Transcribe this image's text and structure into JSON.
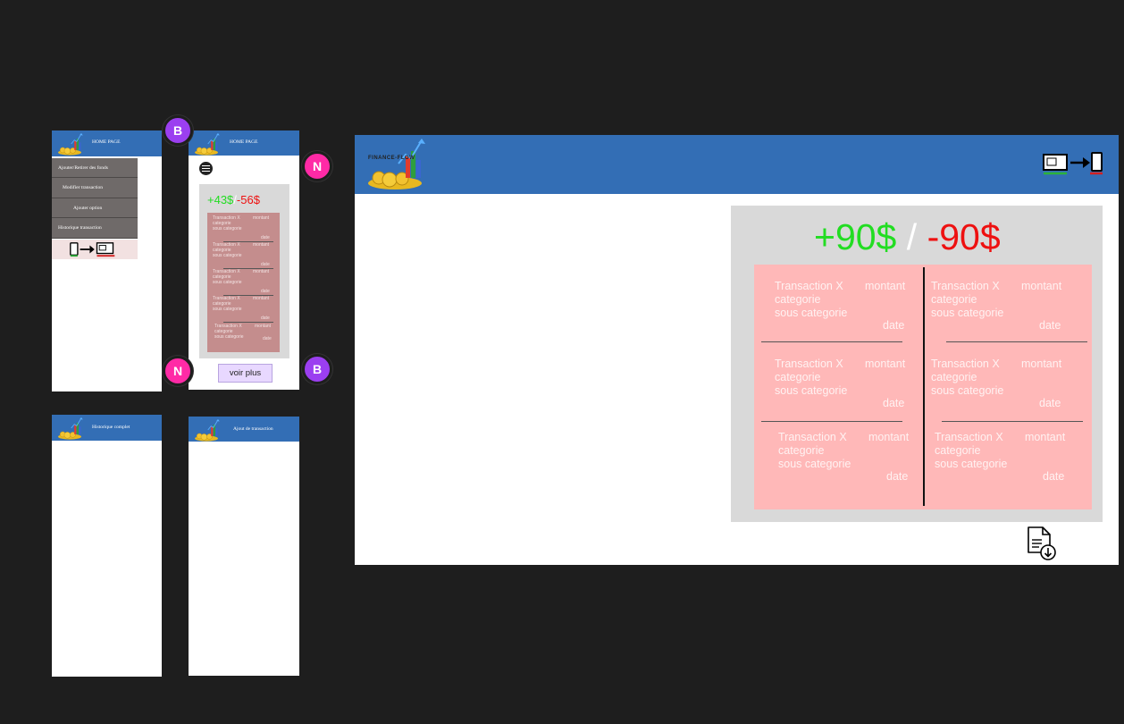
{
  "avatars": {
    "b": "B",
    "n": "N"
  },
  "mobile_menu": {
    "header_title": "HOME PAGE",
    "items": [
      "Ajouter/Retirer des fonds",
      "Modifier transaction",
      "Ajouter option",
      "Historique transaction"
    ]
  },
  "mobile_home": {
    "header_title": "HOME PAGE",
    "income": "+43$",
    "separator": "/",
    "expense": "-56$",
    "transactions": [
      {
        "name": "Transaction X",
        "amount": "montant",
        "category": "categorie",
        "subcategory": "sous categorie",
        "date": "date"
      },
      {
        "name": "Transaction X",
        "amount": "montant",
        "category": "categorie",
        "subcategory": "sous categorie",
        "date": "date"
      },
      {
        "name": "Transaction X",
        "amount": "montant",
        "category": "categorie",
        "subcategory": "sous categorie",
        "date": "date"
      },
      {
        "name": "Transaction X",
        "amount": "montant",
        "category": "categorie",
        "subcategory": "sous categorie",
        "date": "date"
      },
      {
        "name": "Transaction X",
        "amount": "montant",
        "category": "categorie",
        "subcategory": "sous categorie",
        "date": "date"
      }
    ],
    "more_button": "voir plus"
  },
  "mobile_history": {
    "header_title": "Historique complet"
  },
  "mobile_add": {
    "header_title": "Ajout de transaction"
  },
  "desktop": {
    "logo_text": "FINANCE-FLOW",
    "income": "+90$",
    "separator": "/",
    "expense": "-90$",
    "transactions": [
      {
        "name": "Transaction X",
        "amount": "montant",
        "category": "categorie",
        "subcategory": "sous categorie",
        "date": "date"
      },
      {
        "name": "Transaction X",
        "amount": "montant",
        "category": "categorie",
        "subcategory": "sous categorie",
        "date": "date"
      },
      {
        "name": "Transaction X",
        "amount": "montant",
        "category": "categorie",
        "subcategory": "sous categorie",
        "date": "date"
      },
      {
        "name": "Transaction X",
        "amount": "montant",
        "category": "categorie",
        "subcategory": "sous categorie",
        "date": "date"
      },
      {
        "name": "Transaction X",
        "amount": "montant",
        "category": "categorie",
        "subcategory": "sous categorie",
        "date": "date"
      },
      {
        "name": "Transaction X",
        "amount": "montant",
        "category": "categorie",
        "subcategory": "sous categorie",
        "date": "date"
      }
    ],
    "export_icon": "document-download-icon",
    "switch_icon": "desktop-to-mobile-icon"
  },
  "colors": {
    "header": "#336eb5",
    "income": "#22dd22",
    "expense": "#ee1111",
    "card": "#ffb8b8",
    "panel": "#d9d9d9"
  }
}
